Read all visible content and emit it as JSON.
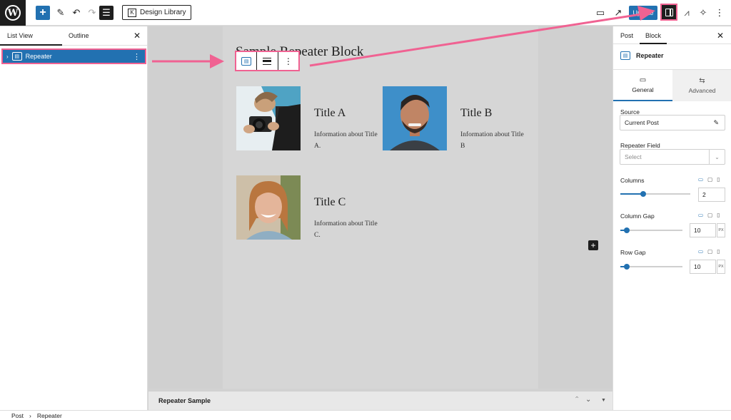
{
  "toolbar": {
    "logo_letter": "W",
    "add_icon": "+",
    "edit_icon": "✎",
    "undo_icon": "↶",
    "redo_icon": "↷",
    "outline_icon": "☰",
    "design_library_label": "Design Library",
    "design_library_icon": "K",
    "desktop_icon": "▭",
    "external_icon": "↗",
    "update_label": "Update",
    "kadence_icon": "⩘",
    "styles_icon": "✧",
    "more_icon": "⋮"
  },
  "list_view": {
    "tab_list": "List View",
    "tab_outline": "Outline",
    "close_icon": "✕",
    "items": [
      {
        "label": "Repeater",
        "chevron": "›",
        "menu": "⋮",
        "icon_glyph": "▤"
      }
    ]
  },
  "canvas": {
    "page_title": "Sample Repeater Block",
    "block_toolbar": {
      "align_glyph": "",
      "more_icon": "⋮",
      "block_icon_glyph": "▤"
    },
    "cards": [
      {
        "title": "Title A",
        "info": "Information about Title A."
      },
      {
        "title": "Title B",
        "info": "Information about Title B"
      },
      {
        "title": "Title C",
        "info": "Information about Title C."
      }
    ],
    "add_block_icon": "+"
  },
  "meta_box": {
    "title": "Repeater Sample",
    "up_icon": "⌃",
    "down_icon": "⌄",
    "caret_icon": "▼"
  },
  "breadcrumb": {
    "items": [
      "Post",
      "Repeater"
    ],
    "separator": "›"
  },
  "settings": {
    "tab_post": "Post",
    "tab_block": "Block",
    "close_icon": "✕",
    "block_name": "Repeater",
    "block_icon_glyph": "▤",
    "subtabs": {
      "general": "General",
      "advanced": "Advanced",
      "general_icon": "▭",
      "advanced_icon": "⇆"
    },
    "source": {
      "label": "Source",
      "value": "Current Post",
      "edit_icon": "✎"
    },
    "repeater_field": {
      "label": "Repeater Field",
      "placeholder": "Select",
      "dropdown_icon": "⌄"
    },
    "responsive_icons": [
      "▭",
      "▢",
      "▯"
    ],
    "columns": {
      "label": "Columns",
      "value": "2",
      "slider_fraction": 0.33
    },
    "column_gap": {
      "label": "Column Gap",
      "value": "10",
      "unit": "PX",
      "slider_fraction": 0.1
    },
    "row_gap": {
      "label": "Row Gap",
      "value": "10",
      "unit": "PX",
      "slider_fraction": 0.1
    }
  },
  "colors": {
    "accent": "#2271b1",
    "annotation": "#f06292",
    "dark": "#1e1e1e"
  }
}
